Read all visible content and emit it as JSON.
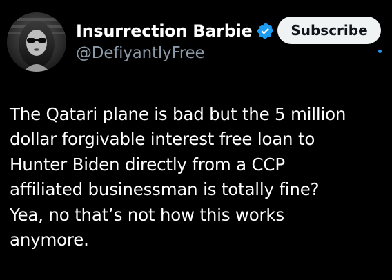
{
  "author": {
    "display_name": "Insurrection Barbie",
    "handle": "@DefiyantlyFree",
    "verified": true,
    "avatar_icon": "profile-photo-avatar",
    "verified_icon": "verified-badge-icon",
    "verified_color": "#1d9bf0"
  },
  "actions": {
    "subscribe_label": "Subscribe"
  },
  "tweet": {
    "lines": [
      "The Qatari plane is bad but the 5 million",
      "dollar forgivable interest free loan to",
      "Hunter Biden directly from a CCP",
      "affiliated businessman is totally fine?",
      "Yea, no that’s not how this works",
      "anymore."
    ]
  },
  "colors": {
    "background": "#000000",
    "text_primary": "#ffffff",
    "text_secondary": "#8b98a5",
    "button_bg": "#eff3f4",
    "accent": "#1d9bf0"
  }
}
